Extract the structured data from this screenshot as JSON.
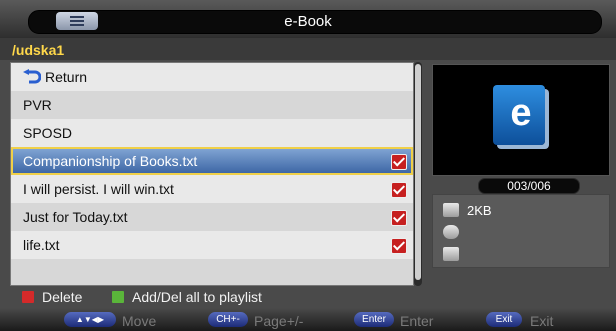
{
  "header": {
    "title": "e-Book",
    "menu_icon": "list-icon"
  },
  "path": "/udska1",
  "list": {
    "items": [
      {
        "label": "Return",
        "icon": "return-arrow-icon",
        "checked": false
      },
      {
        "label": "PVR",
        "checked": false
      },
      {
        "label": "SPOSD",
        "checked": false
      },
      {
        "label": "Companionship of Books.txt",
        "checked": true,
        "selected": true
      },
      {
        "label": "I will persist. I will win.txt",
        "checked": true
      },
      {
        "label": "Just for Today.txt",
        "checked": true
      },
      {
        "label": "life.txt",
        "checked": true
      }
    ]
  },
  "preview": {
    "icon": "ebook-icon",
    "letter": "e",
    "counter": "003/006"
  },
  "info": {
    "size": "2KB"
  },
  "legend": {
    "delete_label": "Delete",
    "delete_color": "#d42a2a",
    "playlist_label": "Add/Del all to playlist",
    "playlist_color": "#5ab53a"
  },
  "footer": {
    "keys": [
      {
        "key": "▲▼◀▶",
        "label": "Move"
      },
      {
        "key": "CH+-",
        "label": "Page+/-"
      },
      {
        "key": "Enter",
        "label": "Enter"
      },
      {
        "key": "Exit",
        "label": "Exit"
      }
    ]
  }
}
